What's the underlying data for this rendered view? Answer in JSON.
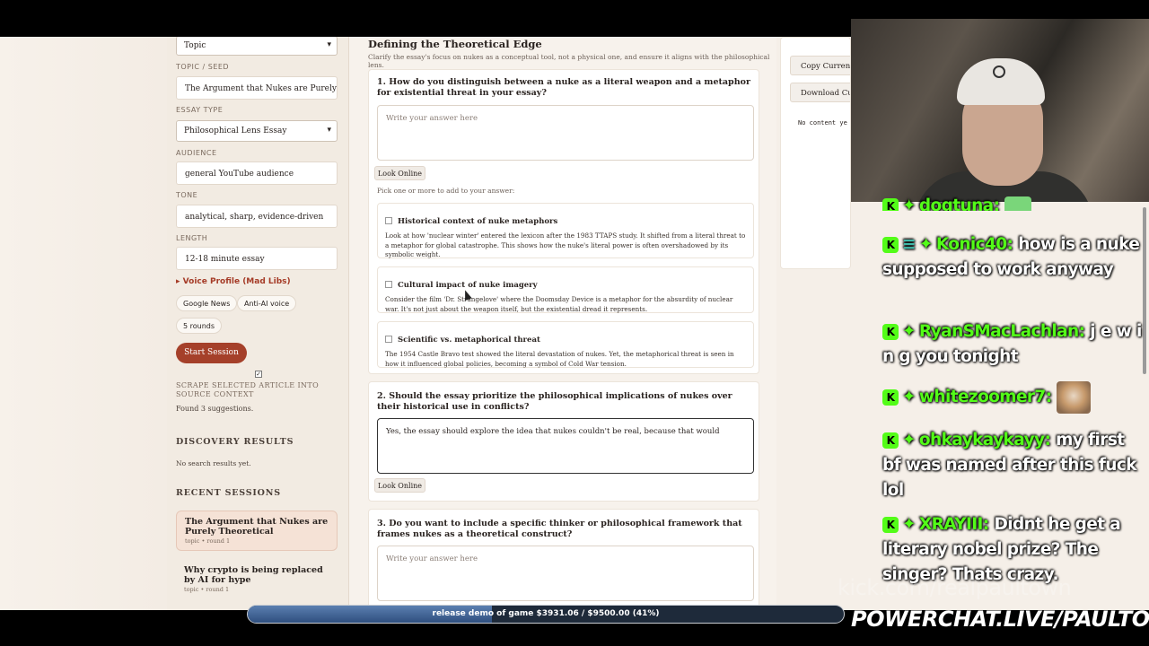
{
  "sidebar": {
    "mode_select": "Topic",
    "topic_label": "TOPIC / SEED",
    "topic_value": "The Argument that Nukes are Purely T",
    "essay_type_label": "ESSAY TYPE",
    "essay_type_value": "Philosophical Lens Essay",
    "audience_label": "AUDIENCE",
    "audience_value": "general YouTube audience",
    "tone_label": "TONE",
    "tone_value": "analytical, sharp, evidence-driven",
    "length_label": "LENGTH",
    "length_value": "12-18 minute essay",
    "voice_profile": "Voice Profile (Mad Libs)",
    "chips": [
      "Google News",
      "Anti-AI voice",
      "5 rounds"
    ],
    "start_button": "Start Session",
    "scrape_check": "✓",
    "scrape_label": "SCRAPE SELECTED ARTICLE INTO SOURCE CONTEXT",
    "found_text": "Found 3 suggestions.",
    "discovery_heading": "DISCOVERY RESULTS",
    "no_results": "No search results yet.",
    "recent_heading": "RECENT SESSIONS",
    "sessions": [
      {
        "title": "The Argument that Nukes are Purely Theoretical",
        "meta": "topic • round 1"
      },
      {
        "title": "Why crypto is being replaced by AI for hype",
        "meta": "topic • round 1"
      }
    ]
  },
  "main": {
    "title": "Defining the Theoretical Edge",
    "subtitle": "Clarify the essay's focus on nukes as a conceptual tool, not a physical one, and ensure it aligns with the philosophical lens.",
    "look_online": "Look Online",
    "pick_hint": "Pick one or more to add to your answer:",
    "questions": [
      {
        "title": "1. How do you distinguish between a nuke as a literal weapon and a metaphor for existential threat in your essay?",
        "placeholder": "Write your answer here",
        "suggestions": [
          {
            "title": "Historical context of nuke metaphors",
            "body": "Look at how 'nuclear winter' entered the lexicon after the 1983 TTAPS study. It shifted from a literal threat to a metaphor for global catastrophe. This shows how the nuke's literal power is often overshadowed by its symbolic weight."
          },
          {
            "title": "Cultural impact of nuke imagery",
            "body": "Consider the film 'Dr. Strangelove' where the Doomsday Device is a metaphor for the absurdity of nuclear war. It's not just about the weapon itself, but the existential dread it represents."
          },
          {
            "title": "Scientific vs. metaphorical threat",
            "body": "The 1954 Castle Bravo test showed the literal devastation of nukes. Yet, the metaphorical threat is seen in how it influenced global policies, becoming a symbol of Cold War tension."
          }
        ]
      },
      {
        "title": "2. Should the essay prioritize the philosophical implications of nukes over their historical use in conflicts?",
        "answer": "Yes, the essay should explore the idea that nukes couldn't be real, because that would"
      },
      {
        "title": "3. Do you want to include a specific thinker or philosophical framework that frames nukes as a theoretical construct?",
        "placeholder": "Write your answer here"
      }
    ]
  },
  "right_panel": {
    "copy_button": "Copy Current",
    "download_button": "Download Cu",
    "empty_text": "No content ye"
  },
  "chat": {
    "messages": [
      {
        "user": "dogtuna:",
        "text": ""
      },
      {
        "user": "Konic40:",
        "text": "how is a nuke supposed to work anyway"
      },
      {
        "user": "RyanSMacLachlan:",
        "text": "j e w i n g you tonight"
      },
      {
        "user": "whitezoomer7:",
        "text": ""
      },
      {
        "user": "ohkaykaykayy:",
        "text": "my first bf was named after this fuck lol"
      },
      {
        "user": "XRAYIII:",
        "text": "Didnt he get a literary nobel prize? The singer? Thats crazy."
      }
    ],
    "badge": "K",
    "watermark": "kick.com/realpaultown"
  },
  "goal": {
    "text": "release demo of game $3931.06 / $9500.00 (41%)",
    "progress": 0.41
  },
  "powerchat": "POWERCHAT.LIVE/PAULTOWN",
  "colors": {
    "accent": "#a5402a",
    "kick_green": "#53fc18"
  }
}
